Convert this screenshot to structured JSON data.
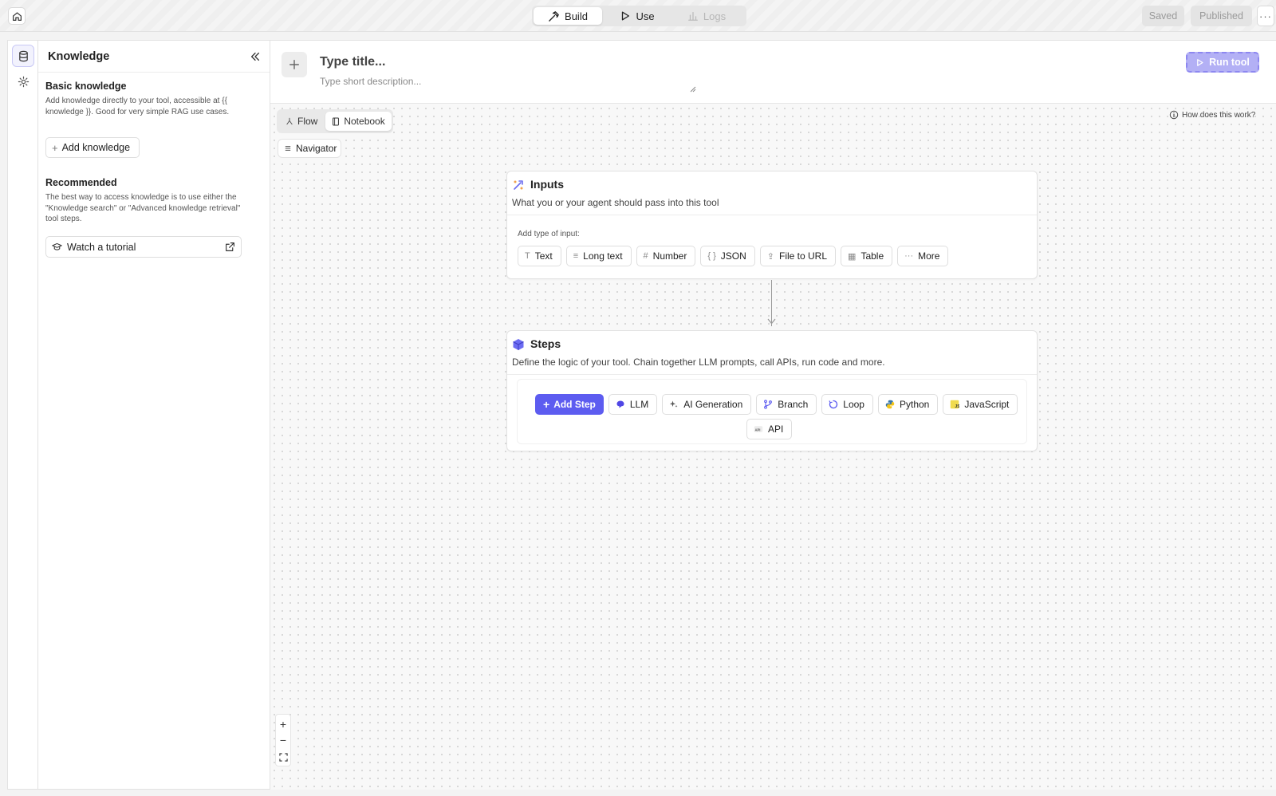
{
  "topbar": {
    "modes": [
      {
        "label": "Build",
        "icon": "hammer-icon",
        "state": "active"
      },
      {
        "label": "Use",
        "icon": "play-icon",
        "state": "normal"
      },
      {
        "label": "Logs",
        "icon": "bar-chart-icon",
        "state": "disabled"
      }
    ],
    "saved_label": "Saved",
    "published_label": "Published",
    "more_label": "···"
  },
  "rail": {
    "items": [
      {
        "icon": "database-icon",
        "active": true
      },
      {
        "icon": "gear-icon",
        "active": false
      }
    ]
  },
  "knowledge": {
    "title": "Knowledge",
    "basic_title": "Basic knowledge",
    "basic_text": "Add knowledge directly to your tool, accessible at {{ knowledge }}. Good for very simple RAG use cases.",
    "add_label": "Add knowledge",
    "recommended_title": "Recommended",
    "recommended_text": "The best way to access knowledge is to use either the \"Knowledge search\" or \"Advanced knowledge retrieval\" tool steps.",
    "tutorial_label": "Watch a tutorial"
  },
  "header": {
    "title_placeholder": "Type title...",
    "desc_placeholder": "Type short description...",
    "run_label": "Run tool"
  },
  "canvas": {
    "views": [
      {
        "label": "Flow",
        "active": false
      },
      {
        "label": "Notebook",
        "active": true
      }
    ],
    "navigator_label": "Navigator",
    "help_label": "How does this work?"
  },
  "inputs_card": {
    "title": "Inputs",
    "description": "What you or your agent should pass into this tool",
    "add_label": "Add type of input:",
    "types": [
      {
        "label": "Text",
        "icon": "T"
      },
      {
        "label": "Long text",
        "icon": "≡"
      },
      {
        "label": "Number",
        "icon": "#"
      },
      {
        "label": "JSON",
        "icon": "{ }"
      },
      {
        "label": "File to URL",
        "icon": "⇪"
      },
      {
        "label": "Table",
        "icon": "▦"
      },
      {
        "label": "More",
        "icon": "···"
      }
    ]
  },
  "steps_card": {
    "title": "Steps",
    "description": "Define the logic of your tool. Chain together LLM prompts, call APIs, run code and more.",
    "add_step_label": "Add Step",
    "step_types": [
      {
        "label": "LLM",
        "icon": "llm-icon",
        "color": "#4f46e5"
      },
      {
        "label": "AI Generation",
        "icon": "sparkle-icon",
        "color": "#555555"
      },
      {
        "label": "Branch",
        "icon": "branch-icon",
        "color": "#5d5cf0"
      },
      {
        "label": "Loop",
        "icon": "loop-icon",
        "color": "#5d5cf0"
      },
      {
        "label": "Python",
        "icon": "python-icon",
        "color": "#3776ab"
      },
      {
        "label": "JavaScript",
        "icon": "javascript-icon",
        "color": "#f0db4f"
      }
    ],
    "api_label": "API"
  },
  "zoom": {
    "in": "+",
    "out": "−"
  },
  "colors": {
    "accent": "#5d5cf0",
    "run_button": "#b3b0f5"
  }
}
